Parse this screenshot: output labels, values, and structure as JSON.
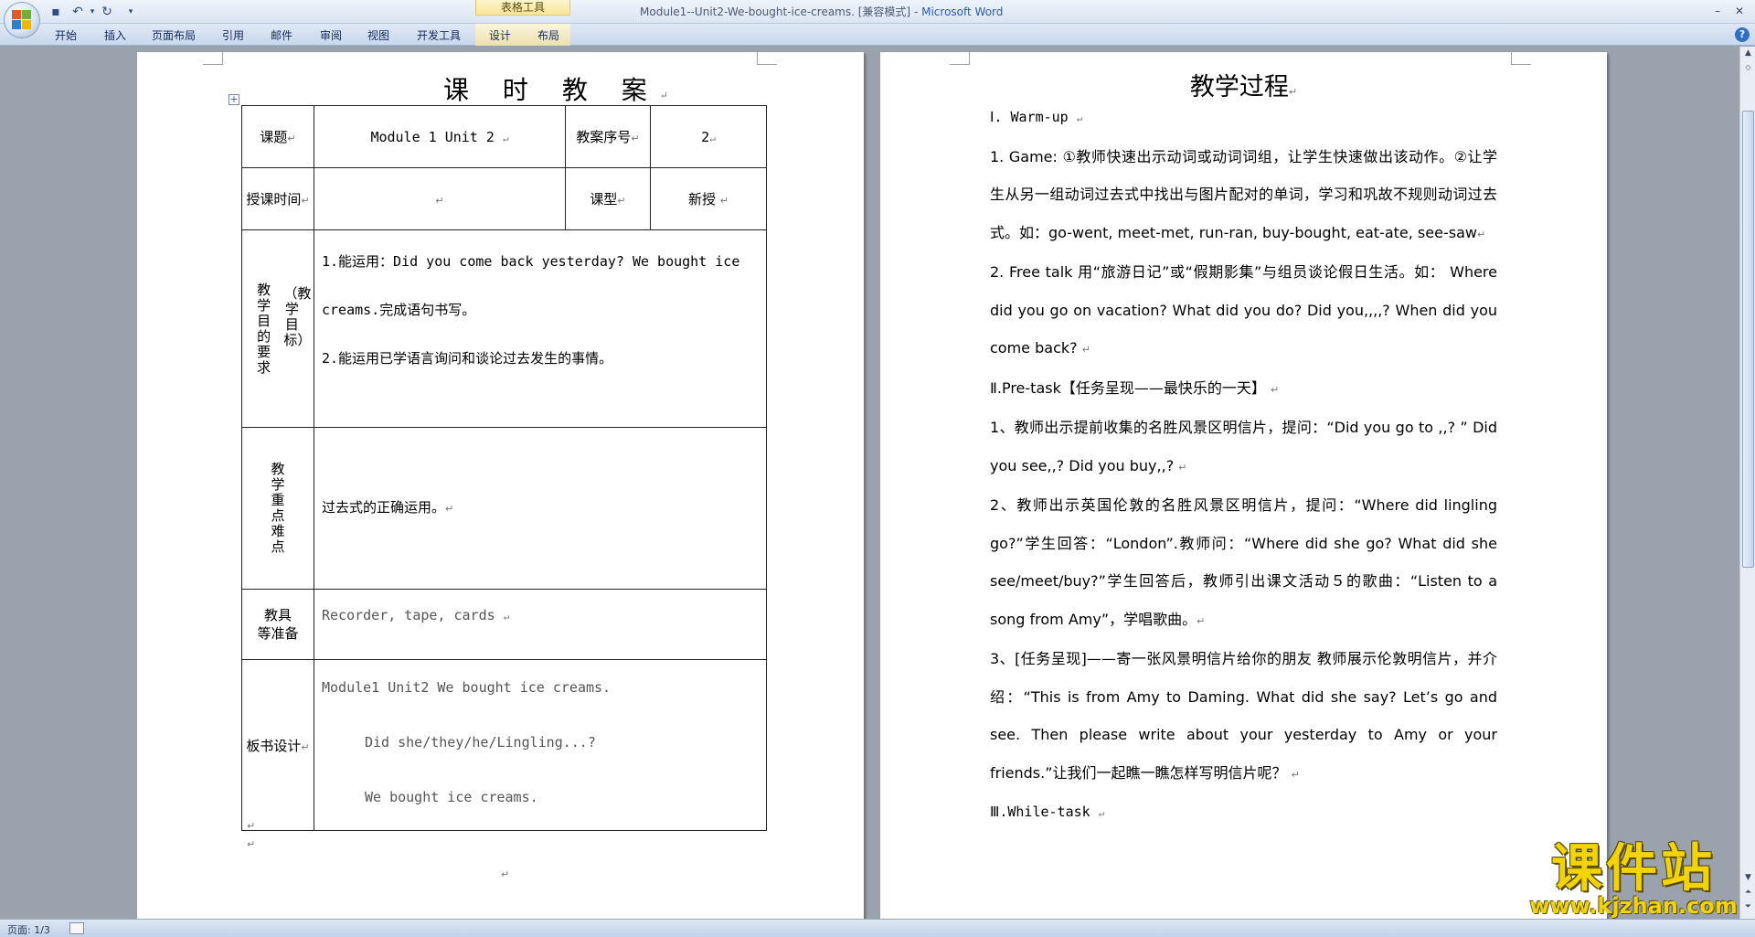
{
  "window": {
    "title": "Module1--Unit2-We-bought-ice-creams. [兼容模式]",
    "app_name": "Microsoft Word",
    "contextual_group": "表格工具"
  },
  "ribbon": {
    "tabs": [
      "开始",
      "插入",
      "页面布局",
      "引用",
      "邮件",
      "审阅",
      "视图",
      "开发工具",
      "设计",
      "布局"
    ]
  },
  "page1": {
    "title": "课 时 教 案",
    "row1": {
      "label": "课题",
      "topic": "Module 1  Unit 2",
      "seq_label": "教案序号",
      "seq_value": "2"
    },
    "row2": {
      "label": "授课时间",
      "time_value": "",
      "type_label": "课型",
      "type_value": "新授"
    },
    "row3": {
      "label_col1": "教学目的要求",
      "label_col2": "（教学目标）",
      "lines": [
        "1.能运用：Did you come back yesterday? We bought ice",
        "creams.完成语句书写。",
        "2.能运用已学语言询问和谈论过去发生的事情。"
      ]
    },
    "row4": {
      "label": "教学重点难点",
      "content": "过去式的正确运用。"
    },
    "row5": {
      "label_line1": "教具",
      "label_line2": "等准备",
      "content": "Recorder, tape, cards"
    },
    "row6": {
      "label": "板书设计",
      "lines": [
        "Module1  Unit2 We bought ice creams.",
        "Did she/they/he/Lingling...?",
        "We bought ice creams."
      ]
    },
    "para_mark": "↵"
  },
  "page2": {
    "title": "教学过程",
    "paragraphs": [
      "Ⅰ. Warm-up",
      "1. Game: ①教师快速出示动词或动词词组，让学生快速做出该动作。②让学生从另一组动词过去式中找出与图片配对的单词，学习和巩故不规则动词过去式。如：go-went, meet-met, run-ran, buy-bought, eat-ate, see-saw",
      "2. Free talk   用“旅游日记”或“假期影集”与组员谈论假日生活。如： Where did you go on vacation?   What did you do?   Did you,,,,?    When did you come back?",
      "Ⅱ.Pre-task【任务呈现——最快乐的一天】",
      "1、教师出示提前收集的名胜风景区明信片，提问：“Did you go to ,,? ” Did you see,,? Did you buy,,?",
      "2、教师出示英国伦敦的名胜风景区明信片，提问：“Where did lingling go?”学生回答：“London”.教师问：“Where did she go? What did she see/meet/buy?”学生回答后，教师引出课文活动５的歌曲：“Listen to a song from Amy”，学唱歌曲。",
      " 3、[任务呈现]——寄一张风景明信片给你的朋友    教师展示伦敦明信片，并介绍：“This is from Amy to Daming. What did she say? Let’s go and see. Then please write about your yesterday to Amy or your friends.”让我们一起瞧一瞧怎样写明信片呢？",
      "Ⅲ.While-task"
    ]
  },
  "status": {
    "page": "页面: 1/3"
  },
  "watermark": {
    "title": "课件站",
    "url": "www.kjzhan.com"
  },
  "colors": {
    "ribbon_bg": "#dbe5f3",
    "workspace_bg": "#9aa2ad",
    "context_tab": "#fbe49a",
    "watermark": "#f1d400"
  }
}
